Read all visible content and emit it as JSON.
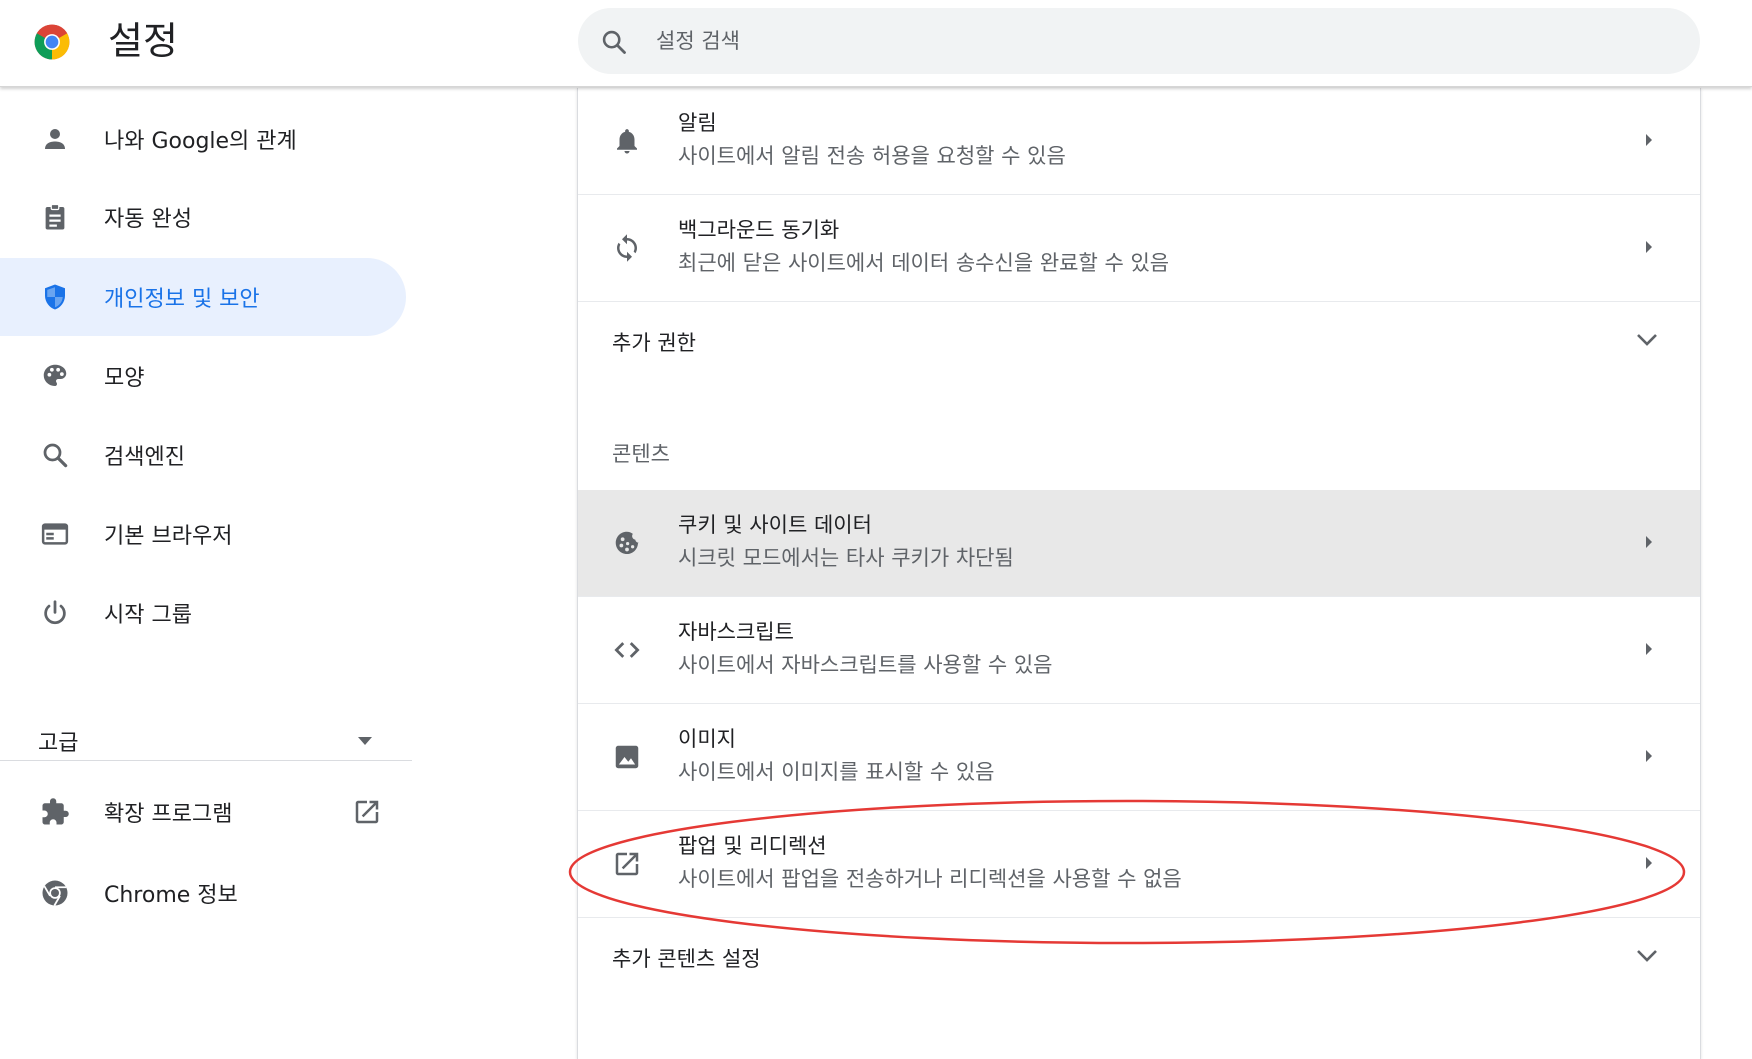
{
  "header": {
    "title": "설정",
    "search_placeholder": "설정 검색"
  },
  "sidebar": {
    "items": [
      {
        "label": "나와 Google의 관계",
        "icon": "person-icon"
      },
      {
        "label": "자동 완성",
        "icon": "clipboard-icon"
      },
      {
        "label": "개인정보 및 보안",
        "icon": "shield-icon",
        "active": true
      },
      {
        "label": "모양",
        "icon": "palette-icon"
      },
      {
        "label": "검색엔진",
        "icon": "search-icon"
      },
      {
        "label": "기본 브라우저",
        "icon": "browser-window-icon"
      },
      {
        "label": "시작 그룹",
        "icon": "power-icon"
      }
    ],
    "advanced_label": "고급",
    "extensions_label": "확장 프로그램",
    "about_label": "Chrome 정보"
  },
  "main": {
    "notifications": {
      "title": "알림",
      "subtitle": "사이트에서 알림 전송 허용을 요청할 수 있음"
    },
    "background_sync": {
      "title": "백그라운드 동기화",
      "subtitle": "최근에 닫은 사이트에서 데이터 송수신을 완료할 수 있음"
    },
    "additional_permissions": "추가 권한",
    "content_heading": "콘텐츠",
    "cookies": {
      "title": "쿠키 및 사이트 데이터",
      "subtitle": "시크릿 모드에서는 타사 쿠키가 차단됨"
    },
    "javascript": {
      "title": "자바스크립트",
      "subtitle": "사이트에서 자바스크립트를 사용할 수 있음"
    },
    "images": {
      "title": "이미지",
      "subtitle": "사이트에서 이미지를 표시할 수 있음"
    },
    "popups": {
      "title": "팝업 및 리디렉션",
      "subtitle": "사이트에서 팝업을 전송하거나 리디렉션을 사용할 수 없음"
    },
    "additional_content": "추가 콘텐츠 설정"
  },
  "colors": {
    "accent": "#1a73e8",
    "active_bg": "#e8f0fe",
    "annotation": "#e53935"
  }
}
